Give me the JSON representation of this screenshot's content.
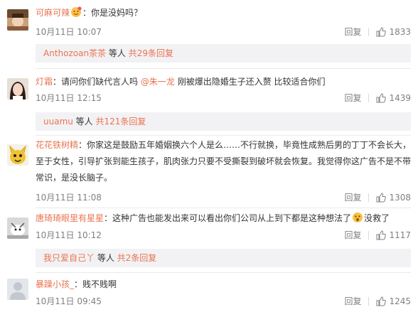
{
  "colors": {
    "accent": "#eb7350",
    "text": "#333333",
    "meta": "#808080",
    "sub_bg": "#f2f2f5"
  },
  "comments": [
    {
      "user": "可麻可辣",
      "sep": "：",
      "text": "你是没妈吗？",
      "time": "10月11日 10:07",
      "reply": "回复",
      "likes": "1833",
      "sub": {
        "users": "Anthozoan茶茶",
        "mid": " 等人 ",
        "link": "共29条回复"
      }
    },
    {
      "user": "灯霜",
      "sep": "：",
      "text_a": "请问你们缺代言人吗 ",
      "mention": "@朱一龙",
      "text_b": " 刚被爆出隐婚生子还入赘 比较适合你们",
      "time": "10月11日 12:15",
      "reply": "回复",
      "likes": "1439",
      "sub": {
        "users": "uuamu",
        "mid": " 等人 ",
        "link": "共121条回复"
      }
    },
    {
      "user": "花花铁树精",
      "sep": "：",
      "text": "你家这是鼓励五年婚姻换六个人是么……不行就换，毕竟性成熟后男的丁丁不会长大，至于女性，引导扩张到能生孩子，肌肉张力只要不受撕裂到破坏就会恢复。我觉得你这广告不是不带常识，是没长脑子。",
      "time": "10月11日 11:08",
      "reply": "回复",
      "likes": "1308"
    },
    {
      "user": "唐琦琦眼里有星星",
      "sep": "：",
      "text": "这种广告也能发出来可以看出你们公司从上到下都是这种想法了",
      "text_tail": "没救了",
      "time": "10月11日 10:12",
      "reply": "回复",
      "likes": "1117",
      "sub": {
        "users": "我只爱自己丫",
        "mid": " 等人 ",
        "link": "共2条回复"
      }
    },
    {
      "user": "暴躁小孩_",
      "sep": "：",
      "text": "贱不贱啊",
      "time": "10月11日 09:45",
      "reply": "回复",
      "likes": "1245"
    }
  ]
}
